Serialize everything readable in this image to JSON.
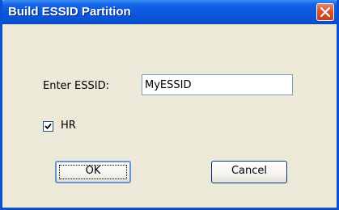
{
  "window": {
    "title": "Build ESSID Partition"
  },
  "form": {
    "essid_label": "Enter ESSID:",
    "essid_value": "MyESSID",
    "hr_label": "HR",
    "hr_checked": true
  },
  "buttons": {
    "ok_label": "OK",
    "cancel_label": "Cancel"
  },
  "icons": {
    "close": "close-icon",
    "checkmark": "checkmark-icon"
  },
  "colors": {
    "titlebar": "#0a56dc",
    "dialog_background": "#ece9d8",
    "close_button": "#d9512c"
  }
}
